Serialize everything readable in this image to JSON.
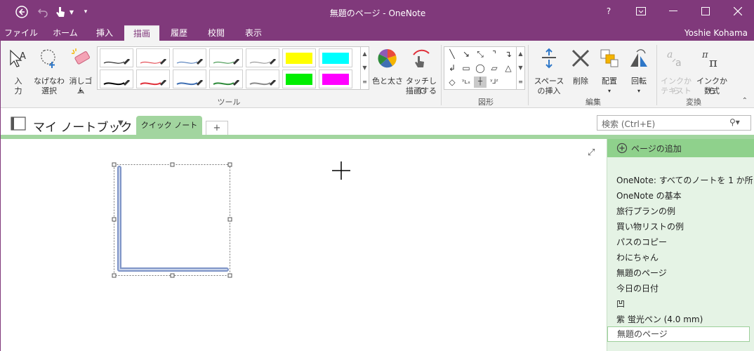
{
  "window": {
    "title": "無題のページ - OneNote",
    "help": "?"
  },
  "menu_tabs": [
    "ファイル",
    "ホーム",
    "挿入",
    "描画",
    "履歴",
    "校閲",
    "表示"
  ],
  "active_tab": "描画",
  "user_name": "Yoshie Kohama",
  "ribbon": {
    "input_label_1": "入",
    "input_label_2": "力",
    "lasso_label_1": "なげなわ",
    "lasso_label_2": "選択",
    "eraser_label": "消しゴム",
    "color_thickness_label": "色と太さ",
    "touch_draw_label_1": "タッチして",
    "touch_draw_label_2": "描画する",
    "space_insert_label_1": "スペース",
    "space_insert_label_2": "の挿入",
    "delete_label": "削除",
    "arrange_label": "配置",
    "rotate_label": "回転",
    "ink_to_text_label_1": "インクから",
    "ink_to_text_label_2": "テキスト",
    "ink_to_math_label_1": "インクから",
    "ink_to_math_label_2": "数式",
    "group_tools": "ツール",
    "group_shapes": "図形",
    "group_edit": "編集",
    "group_convert": "変換"
  },
  "pens": [
    {
      "color": "#000000",
      "style": "thin"
    },
    {
      "color": "#e0303a",
      "style": "thin"
    },
    {
      "color": "#3f6fb3",
      "style": "thin"
    },
    {
      "color": "#2e8b3a",
      "style": "thin"
    },
    {
      "color": "#8a8a8a",
      "style": "thin"
    },
    {
      "color": "#ffff00",
      "style": "highlighter"
    },
    {
      "color": "#00ffff",
      "style": "highlighter"
    },
    {
      "color": "#000000",
      "style": "thick"
    },
    {
      "color": "#e0303a",
      "style": "thick"
    },
    {
      "color": "#3f6fb3",
      "style": "thick"
    },
    {
      "color": "#2e8b3a",
      "style": "thick"
    },
    {
      "color": "#8a8a8a",
      "style": "thick"
    },
    {
      "color": "#00ee00",
      "style": "highlighter"
    },
    {
      "color": "#ff00ff",
      "style": "highlighter"
    }
  ],
  "notebook": {
    "name": "マイ ノートブック",
    "section_tab": "クイック ノート",
    "add_section": "+",
    "search_placeholder": "検索 (Ctrl+E)"
  },
  "pages": {
    "add_page": "ページの追加",
    "items": [
      "OneNote: すべてのノートを 1 か所",
      "OneNote の基本",
      "旅行プランの例",
      "買い物リストの例",
      "パスのコピー",
      "わにちゃん",
      "無題のページ",
      "今日の日付",
      "凹",
      "紫 蛍光ペン (4.0 mm)"
    ],
    "selected": "無題のページ"
  },
  "colors": {
    "accent": "#80397b",
    "section": "#a2d59f",
    "page_list_bg": "#e5f3e5",
    "ink_stroke": "#7f95c7"
  }
}
